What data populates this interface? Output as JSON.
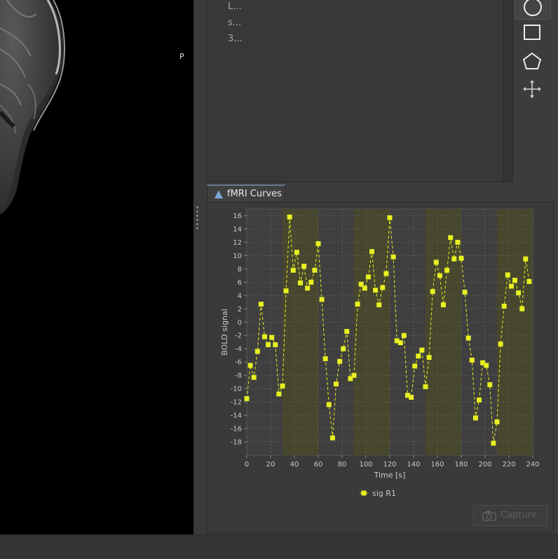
{
  "viewer": {
    "orientation_label": "P"
  },
  "roi_panel": {
    "rows": [
      "L...",
      "s...",
      "3..."
    ]
  },
  "tools": [
    {
      "name": "circle-tool",
      "icon": "circle-icon"
    },
    {
      "name": "rectangle-tool",
      "icon": "rectangle-icon"
    },
    {
      "name": "polygon-tool",
      "icon": "polygon-icon"
    },
    {
      "name": "move-tool",
      "icon": "move-icon"
    }
  ],
  "curves_tab": {
    "label": "fMRI Curves",
    "icon": "chart-icon"
  },
  "capture_button": {
    "label": "Capture",
    "icon": "camera-icon"
  },
  "colors": {
    "series": "#e8f020",
    "block": "#46472d",
    "bg": "#3f3f3f"
  },
  "chart_data": {
    "type": "line",
    "xlabel": "Time [s]",
    "ylabel": "BOLD signal",
    "xlim": [
      0,
      240
    ],
    "ylim": [
      -20,
      17
    ],
    "xticks": [
      0,
      20,
      40,
      60,
      80,
      100,
      120,
      140,
      160,
      180,
      200,
      220,
      240
    ],
    "yticks": [
      -18,
      -16,
      -14,
      -12,
      -10,
      -8,
      -6,
      -4,
      -2,
      0,
      2,
      4,
      6,
      8,
      10,
      12,
      14,
      16
    ],
    "grid": true,
    "legend": "bottom",
    "blocks": [
      [
        30,
        60
      ],
      [
        90,
        120
      ],
      [
        150,
        180
      ],
      [
        210,
        240
      ]
    ],
    "series": [
      {
        "name": "sig R1",
        "x": [
          0,
          3,
          6,
          9,
          12,
          15,
          18,
          21,
          24,
          27,
          30,
          33,
          36,
          39,
          42,
          45,
          48,
          51,
          54,
          57,
          60,
          63,
          66,
          69,
          72,
          75,
          78,
          81,
          84,
          87,
          90,
          93,
          96,
          99,
          102,
          105,
          108,
          111,
          114,
          117,
          120,
          123,
          126,
          129,
          132,
          135,
          138,
          141,
          144,
          147,
          150,
          153,
          156,
          159,
          162,
          165,
          168,
          171,
          174,
          177,
          180,
          183,
          186,
          189,
          192,
          195,
          198,
          201,
          204,
          207,
          210,
          213,
          216,
          219,
          222,
          225,
          228,
          231,
          234,
          237
        ],
        "values": [
          -11.5,
          -6.5,
          -8.3,
          -4.4,
          2.7,
          -2.2,
          -3.4,
          -2.3,
          -3.4,
          -10.8,
          -9.6,
          4.7,
          15.8,
          7.8,
          10.5,
          5.9,
          8.4,
          5.1,
          6.0,
          7.8,
          11.8,
          3.4,
          -5.5,
          -12.4,
          -17.4,
          -9.3,
          -5.9,
          -4.0,
          -1.4,
          -8.5,
          -8.0,
          2.7,
          5.7,
          5.1,
          6.8,
          10.6,
          4.8,
          2.6,
          5.2,
          7.3,
          15.7,
          9.8,
          -2.8,
          -3.1,
          -2.0,
          -11.0,
          -11.3,
          -6.6,
          -5.1,
          -4.2,
          -9.7,
          -5.3,
          4.6,
          9.0,
          7.0,
          2.6,
          7.8,
          12.7,
          9.5,
          12.0,
          9.6,
          4.5,
          -2.4,
          -5.7,
          -14.4,
          -11.7,
          -6.1,
          -6.5,
          -9.4,
          -18.2,
          -15.0,
          -3.3,
          2.4,
          7.1,
          5.4,
          6.3,
          4.4,
          2.0,
          9.5,
          6.1
        ]
      }
    ]
  }
}
